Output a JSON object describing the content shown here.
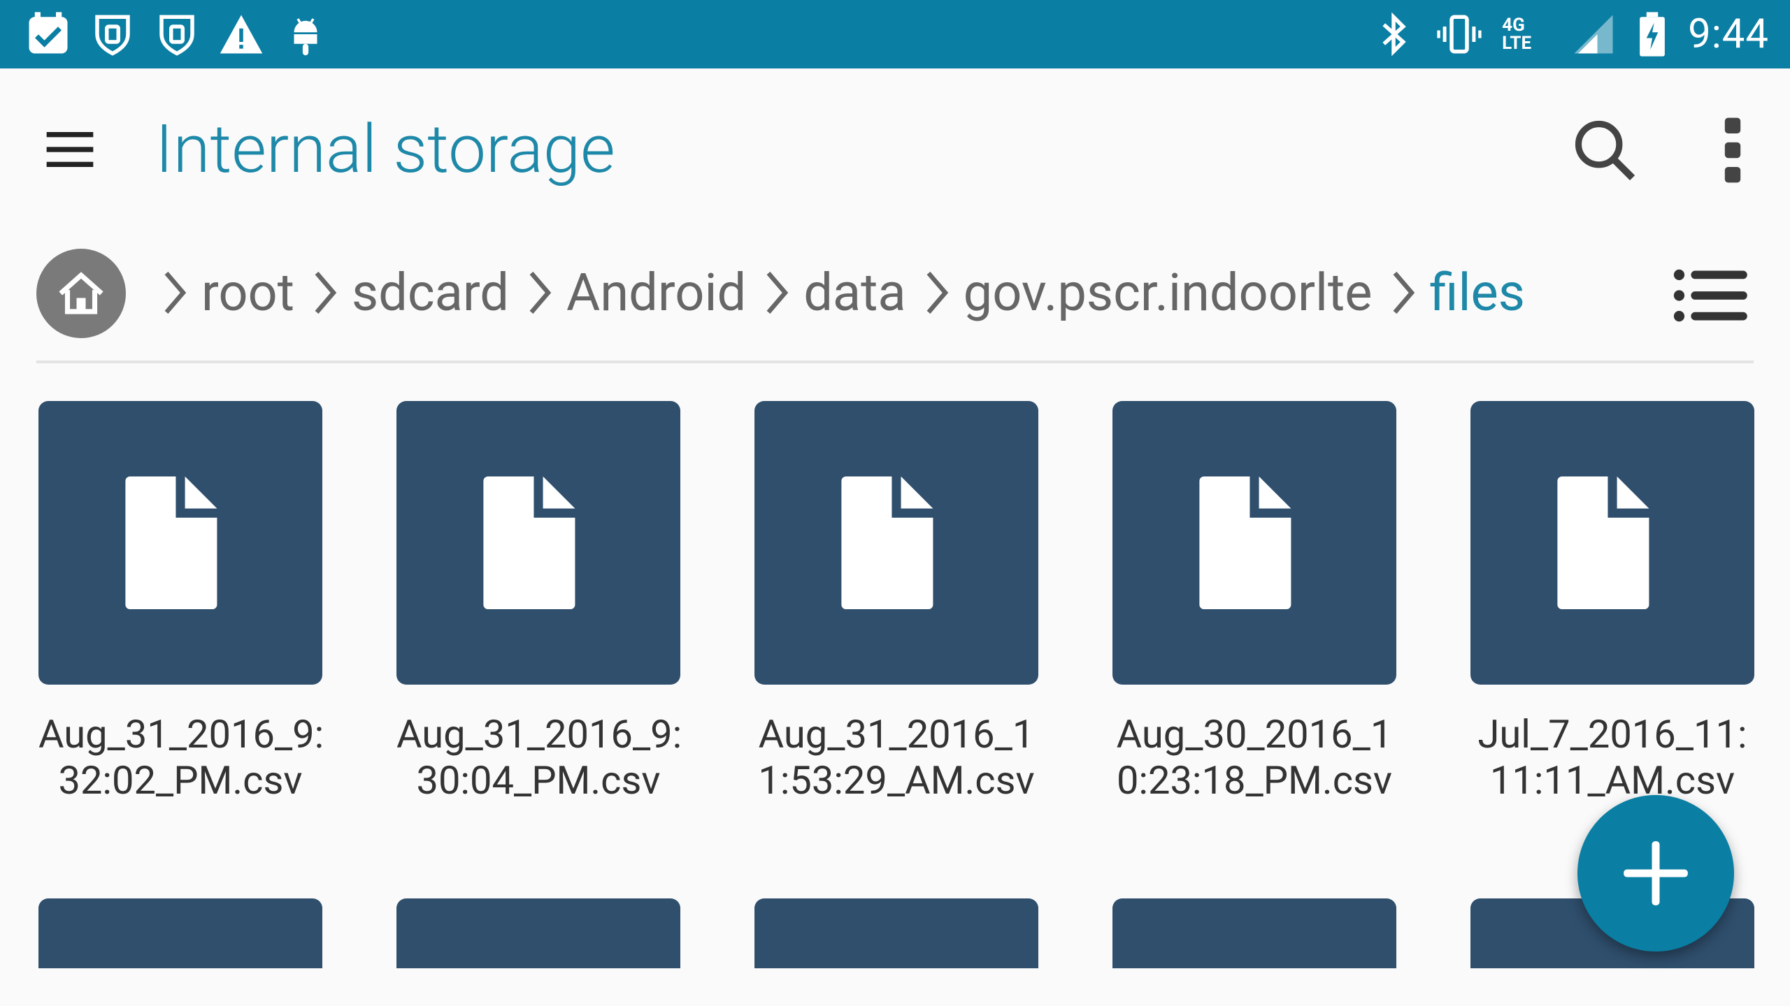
{
  "status_bar": {
    "left_icons": [
      "task-check-icon",
      "shield-icon",
      "shield-icon",
      "warning-icon",
      "android-icon"
    ],
    "right_icons": [
      "bluetooth-icon",
      "vibrate-icon",
      "signal-icon",
      "battery-charging-icon"
    ],
    "network": "4G LTE",
    "time": "9:44",
    "bg_color": "#0a7ea3"
  },
  "appbar": {
    "title": "Internal storage",
    "title_color": "#1e88a8"
  },
  "breadcrumbs": [
    {
      "label": "root",
      "active": false
    },
    {
      "label": "sdcard",
      "active": false
    },
    {
      "label": "Android",
      "active": false
    },
    {
      "label": "data",
      "active": false
    },
    {
      "label": "gov.pscr.indoorlte",
      "active": false
    },
    {
      "label": "files",
      "active": true
    }
  ],
  "files": [
    {
      "name": "Aug_31_2016_9:\n32:02_PM.csv"
    },
    {
      "name": "Aug_31_2016_9:\n30:04_PM.csv"
    },
    {
      "name": "Aug_31_2016_1\n1:53:29_AM.csv"
    },
    {
      "name": "Aug_30_2016_1\n0:23:18_PM.csv"
    },
    {
      "name": "Jul_7_2016_11:\n11:11_AM.csv"
    }
  ],
  "tile_color": "#2f4f6d",
  "fab": {
    "icon": "plus-icon"
  }
}
